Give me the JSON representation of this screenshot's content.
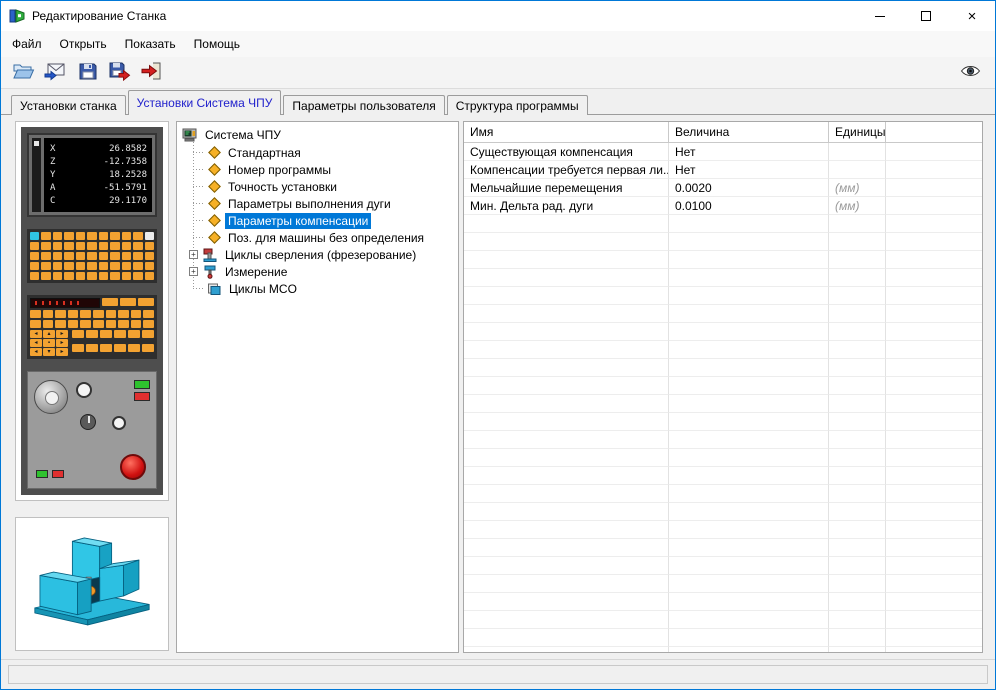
{
  "window": {
    "title": "Редактирование Станка",
    "controls": [
      "minimize",
      "maximize",
      "close"
    ]
  },
  "menu": {
    "items": [
      "Файл",
      "Открыть",
      "Показать",
      "Помощь"
    ]
  },
  "toolbar": {
    "buttons": [
      "open-folder-icon",
      "mail-import-icon",
      "save-icon",
      "save-as-icon",
      "exit-icon"
    ],
    "view_button": "eye-icon"
  },
  "tabs": [
    {
      "label": "Установки станка",
      "active": false
    },
    {
      "label": "Установки Система ЧПУ",
      "active": true
    },
    {
      "label": "Параметры пользователя",
      "active": false
    },
    {
      "label": "Структура программы",
      "active": false
    }
  ],
  "machine_display": {
    "axes": [
      {
        "axis": "X",
        "value": "26.8582"
      },
      {
        "axis": "Z",
        "value": "-12.7358"
      },
      {
        "axis": "Y",
        "value": "18.2528"
      },
      {
        "axis": "A",
        "value": "-51.5791"
      },
      {
        "axis": "C",
        "value": "29.1170"
      }
    ]
  },
  "tree": {
    "root": {
      "label": "Система ЧПУ",
      "icon": "cnc-system-icon"
    },
    "items": [
      {
        "label": "Стандартная",
        "icon": "diamond-icon",
        "expandable": false,
        "selected": false
      },
      {
        "label": "Номер программы",
        "icon": "diamond-icon",
        "expandable": false,
        "selected": false
      },
      {
        "label": "Точность установки",
        "icon": "diamond-icon",
        "expandable": false,
        "selected": false
      },
      {
        "label": "Параметры выполнения дуги",
        "icon": "diamond-icon",
        "expandable": false,
        "selected": false
      },
      {
        "label": "Параметры компенсации",
        "icon": "diamond-icon",
        "expandable": false,
        "selected": true
      },
      {
        "label": "Поз. для машины без определения",
        "icon": "diamond-icon",
        "expandable": false,
        "selected": false
      },
      {
        "label": "Циклы сверления (фрезерование)",
        "icon": "drill-cycles-icon",
        "expandable": true,
        "selected": false
      },
      {
        "label": "Измерение",
        "icon": "measurement-icon",
        "expandable": true,
        "selected": false
      },
      {
        "label": "Циклы MCO",
        "icon": "mco-cycles-icon",
        "expandable": false,
        "selected": false
      }
    ]
  },
  "param_table": {
    "columns": [
      "Имя",
      "Величина",
      "Единицы"
    ],
    "rows": [
      {
        "name": "Существующая компенсация",
        "value": "Нет",
        "unit": ""
      },
      {
        "name": "Компенсации требуется первая ли...",
        "value": "Нет",
        "unit": ""
      },
      {
        "name": "Мельчайшие перемещения",
        "value": "0.0020",
        "unit": "(мм)"
      },
      {
        "name": "Мин. Дельта рад. дуги",
        "value": "0.0100",
        "unit": "(мм)"
      }
    ]
  },
  "colors": {
    "window_border": "#0078d7",
    "selection": "#0078d7",
    "active_tab_text": "#2222cc",
    "key_orange": "#f3a231",
    "machine_cyan": "#2cc0e2"
  }
}
